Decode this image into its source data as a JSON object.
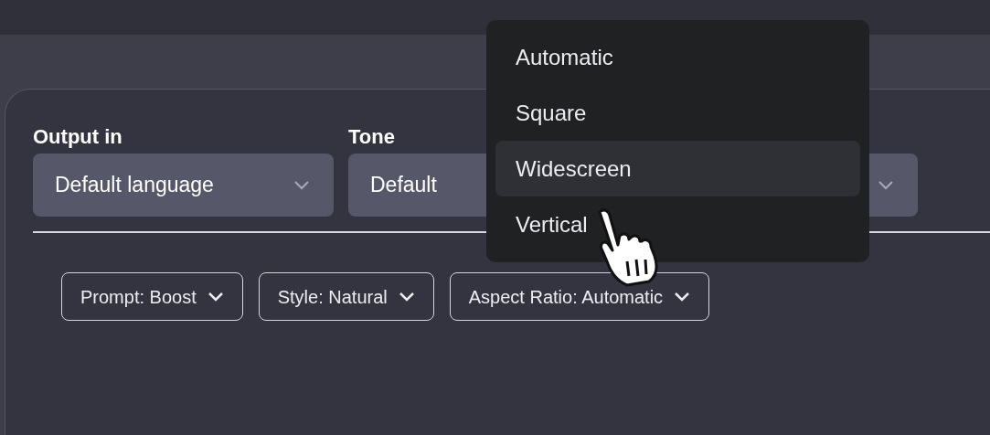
{
  "fields": [
    {
      "kind": "select",
      "label": "Output in",
      "value": "Default language"
    },
    {
      "kind": "select",
      "label": "Tone",
      "value": "Default"
    },
    {
      "kind": "select"
    }
  ],
  "dropdown_menu": [
    {
      "label": "Automatic",
      "selected": false
    },
    {
      "label": "Square",
      "selected": false
    },
    {
      "label": "Widescreen",
      "selected": true
    },
    {
      "label": "Vertical",
      "selected": false
    }
  ],
  "chips": [
    {
      "label": "Prompt: Boost"
    },
    {
      "label": "Style: Natural"
    },
    {
      "label": "Aspect Ratio: Automatic"
    }
  ]
}
